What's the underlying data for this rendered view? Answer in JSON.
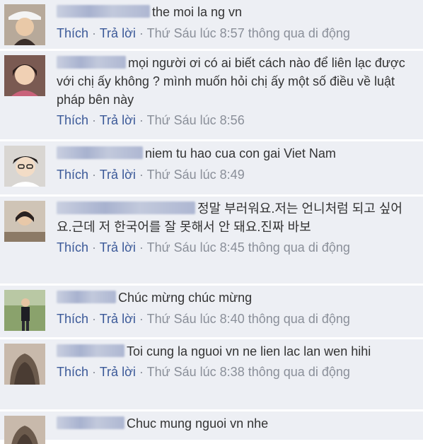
{
  "comments": [
    {
      "text": "the moi la ng vn",
      "like": "Thích",
      "reply": "Trả lời",
      "time": "Thứ Sáu lúc 8:57",
      "via": "thông qua di động",
      "avatar_icon": "user-avatar-icon"
    },
    {
      "text": "mọi người ơi có ai biết cách nào để liên lạc được với chị ấy không ? mình muốn hỏi chị ấy một số điều về luật pháp bên này",
      "like": "Thích",
      "reply": "Trả lời",
      "time": "Thứ Sáu lúc 8:56",
      "via": "",
      "avatar_icon": "user-avatar-icon"
    },
    {
      "text": "niem tu hao cua con gai Viet Nam",
      "like": "Thích",
      "reply": "Trả lời",
      "time": "Thứ Sáu lúc 8:49",
      "via": "",
      "avatar_icon": "user-avatar-icon"
    },
    {
      "text": "정말 부러워요.저는 언니처럼 되고 싶어요.근데 저 한국어를 잘 못해서 안 돼요.진짜 바보",
      "like": "Thích",
      "reply": "Trả lời",
      "time": "Thứ Sáu lúc 8:45",
      "via": "thông qua di động",
      "avatar_icon": "user-avatar-icon"
    },
    {
      "text": "Chúc mừng chúc mừng",
      "like": "Thích",
      "reply": "Trả lời",
      "time": "Thứ Sáu lúc 8:40",
      "via": "thông qua di động",
      "avatar_icon": "user-avatar-icon"
    },
    {
      "text": "Toi cung la nguoi vn ne lien lac lan wen hihi",
      "like": "Thích",
      "reply": "Trả lời",
      "time": "Thứ Sáu lúc 8:38",
      "via": "thông qua di động",
      "avatar_icon": "user-avatar-icon"
    },
    {
      "text": "Chuc mung nguoi vn nhe",
      "like": "",
      "reply": "",
      "time": "",
      "via": "",
      "avatar_icon": "user-avatar-icon"
    }
  ],
  "separator": "·"
}
